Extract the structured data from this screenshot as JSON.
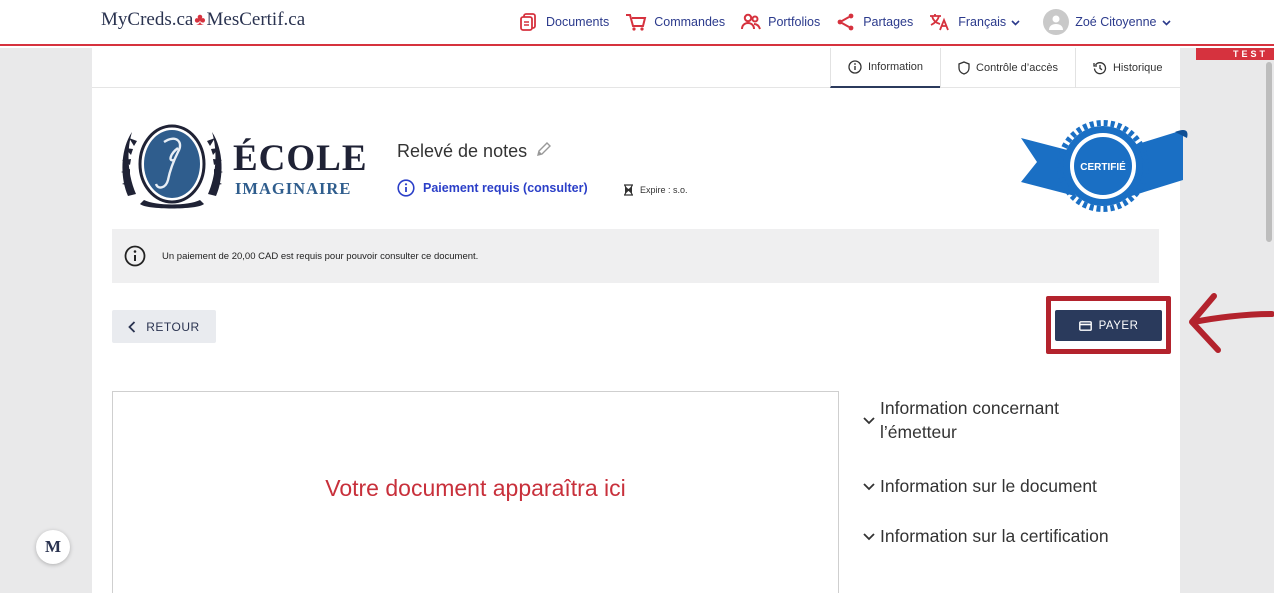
{
  "brand": {
    "left": "MyCreds.ca",
    "right": "MesCertif.ca",
    "accent": "#d6323e",
    "navy": "#2a3a5c"
  },
  "nav": {
    "documents": "Documents",
    "orders": "Commandes",
    "portfolios": "Portfolios",
    "shares": "Partages",
    "language": "Français",
    "user": "Zoé Citoyenne"
  },
  "env_badge": "TEST",
  "tabs": {
    "information": "Information",
    "access": "Contrôle d’accès",
    "history": "Historique"
  },
  "issuer": {
    "name_line1": "ÉCOLE",
    "name_line2": "IMAGINAIRE"
  },
  "document": {
    "title": "Relevé de notes",
    "payment_status": "Paiement requis (consulter)",
    "expiry": "Expire : s.o.",
    "badge": "CERTIFIÉ"
  },
  "alert": {
    "message": "Un paiement de 20,00 CAD est requis pour pouvoir consulter ce document."
  },
  "actions": {
    "back": "RETOUR",
    "pay": "PAYER"
  },
  "preview": {
    "placeholder": "Votre document apparaîtra ici"
  },
  "accordion": {
    "issuer_info": "Information concernant l’émetteur",
    "document_info": "Information sur le document",
    "certification_info": "Information sur la certification"
  },
  "footer_logo": "M"
}
